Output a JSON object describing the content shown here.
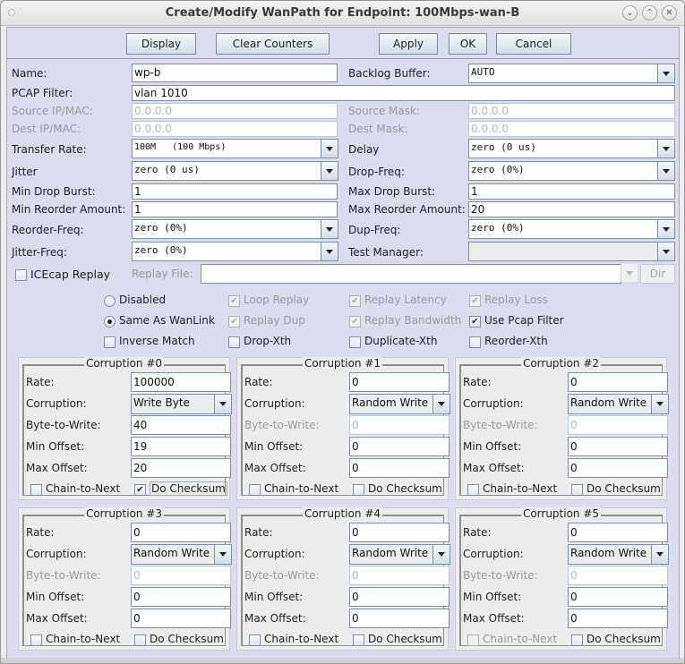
{
  "window": {
    "title": "Create/Modify WanPath for Endpoint: 100Mbps-wan-B",
    "controls": [
      "minimize",
      "maximize",
      "close"
    ]
  },
  "toolbar": {
    "display_label": "Display",
    "clear_counters_label": "Clear Counters",
    "apply_label": "Apply",
    "ok_label": "OK",
    "cancel_label": "Cancel"
  },
  "form": {
    "name": {
      "label": "Name:",
      "value": "wp-b"
    },
    "backlog_buffer": {
      "label": "Backlog Buffer:",
      "value": "AUTO"
    },
    "pcap_filter": {
      "label": "PCAP Filter:",
      "value": "vlan 1010"
    },
    "source_ip": {
      "label": "Source IP/MAC:",
      "value": "0.0.0.0"
    },
    "source_mask": {
      "label": "Source Mask:",
      "value": "0.0.0.0"
    },
    "dest_ip": {
      "label": "Dest IP/MAC:",
      "value": "0.0.0.0"
    },
    "dest_mask": {
      "label": "Dest Mask:",
      "value": "0.0.0.0"
    },
    "transfer_rate": {
      "label": "Transfer Rate:",
      "value": "100M   (100 Mbps)"
    },
    "delay": {
      "label": "Delay",
      "value": "zero (0 us)"
    },
    "jitter": {
      "label": "Jitter",
      "value": "zero (0 us)"
    },
    "drop_freq": {
      "label": "Drop-Freq:",
      "value": "zero (0%)"
    },
    "min_drop_burst": {
      "label": "Min Drop Burst:",
      "value": "1"
    },
    "max_drop_burst": {
      "label": "Max Drop Burst:",
      "value": "1"
    },
    "min_reorder": {
      "label": "Min Reorder Amount:",
      "value": "1"
    },
    "max_reorder": {
      "label": "Max Reorder Amount:",
      "value": "20"
    },
    "reorder_freq": {
      "label": "Reorder-Freq:",
      "value": "zero (0%)"
    },
    "dup_freq": {
      "label": "Dup-Freq:",
      "value": "zero (0%)"
    },
    "jitter_freq": {
      "label": "Jitter-Freq:",
      "value": "zero (0%)"
    },
    "test_manager": {
      "label": "Test Manager:",
      "value": ""
    },
    "icecap_replay": {
      "label": "ICEcap Replay",
      "checked": false
    },
    "replay_file": {
      "label": "Replay File:",
      "value": ""
    },
    "dir_label": "Dir"
  },
  "options": {
    "disabled": {
      "label": "Disabled",
      "selected": false
    },
    "same_as_wanlink": {
      "label": "Same As WanLink",
      "selected": true
    },
    "inverse_match": {
      "label": "Inverse Match",
      "checked": false
    },
    "loop_replay": {
      "label": "Loop Replay",
      "checked": true,
      "enabled": false
    },
    "replay_dup": {
      "label": "Replay Dup",
      "checked": true,
      "enabled": false
    },
    "drop_xth": {
      "label": "Drop-Xth",
      "checked": false
    },
    "replay_latency": {
      "label": "Replay Latency",
      "checked": true,
      "enabled": false
    },
    "replay_bandwidth": {
      "label": "Replay Bandwidth",
      "checked": true,
      "enabled": false
    },
    "duplicate_xth": {
      "label": "Duplicate-Xth",
      "checked": false
    },
    "replay_loss": {
      "label": "Replay Loss",
      "checked": true,
      "enabled": false
    },
    "use_pcap_filter": {
      "label": "Use Pcap Filter",
      "checked": true
    },
    "reorder_xth": {
      "label": "Reorder-Xth",
      "checked": false
    }
  },
  "corruption_labels": {
    "rate": "Rate:",
    "corruption": "Corruption:",
    "byte_to_write": "Byte-to-Write:",
    "min_offset": "Min Offset:",
    "max_offset": "Max Offset:",
    "chain_to_next": "Chain-to-Next",
    "do_checksum": "Do Checksum"
  },
  "corruptions": [
    {
      "title": "Corruption #0",
      "rate": "100000",
      "type": "Write Byte",
      "byte_to_write": "40",
      "byte_enabled": true,
      "min_offset": "19",
      "max_offset": "20",
      "chain_to_next": false,
      "chain_enabled": true,
      "do_checksum": true
    },
    {
      "title": "Corruption #1",
      "rate": "0",
      "type": "Random Write",
      "byte_to_write": "0",
      "byte_enabled": false,
      "min_offset": "0",
      "max_offset": "0",
      "chain_to_next": false,
      "chain_enabled": true,
      "do_checksum": false
    },
    {
      "title": "Corruption #2",
      "rate": "0",
      "type": "Random Write",
      "byte_to_write": "0",
      "byte_enabled": false,
      "min_offset": "0",
      "max_offset": "0",
      "chain_to_next": false,
      "chain_enabled": true,
      "do_checksum": false
    },
    {
      "title": "Corruption #3",
      "rate": "0",
      "type": "Random Write",
      "byte_to_write": "0",
      "byte_enabled": false,
      "min_offset": "0",
      "max_offset": "0",
      "chain_to_next": false,
      "chain_enabled": true,
      "do_checksum": false
    },
    {
      "title": "Corruption #4",
      "rate": "0",
      "type": "Random Write",
      "byte_to_write": "0",
      "byte_enabled": false,
      "min_offset": "0",
      "max_offset": "0",
      "chain_to_next": false,
      "chain_enabled": true,
      "do_checksum": false
    },
    {
      "title": "Corruption #5",
      "rate": "0",
      "type": "Random Write",
      "byte_to_write": "0",
      "byte_enabled": false,
      "min_offset": "0",
      "max_offset": "0",
      "chain_to_next": false,
      "chain_enabled": false,
      "do_checksum": false
    }
  ]
}
